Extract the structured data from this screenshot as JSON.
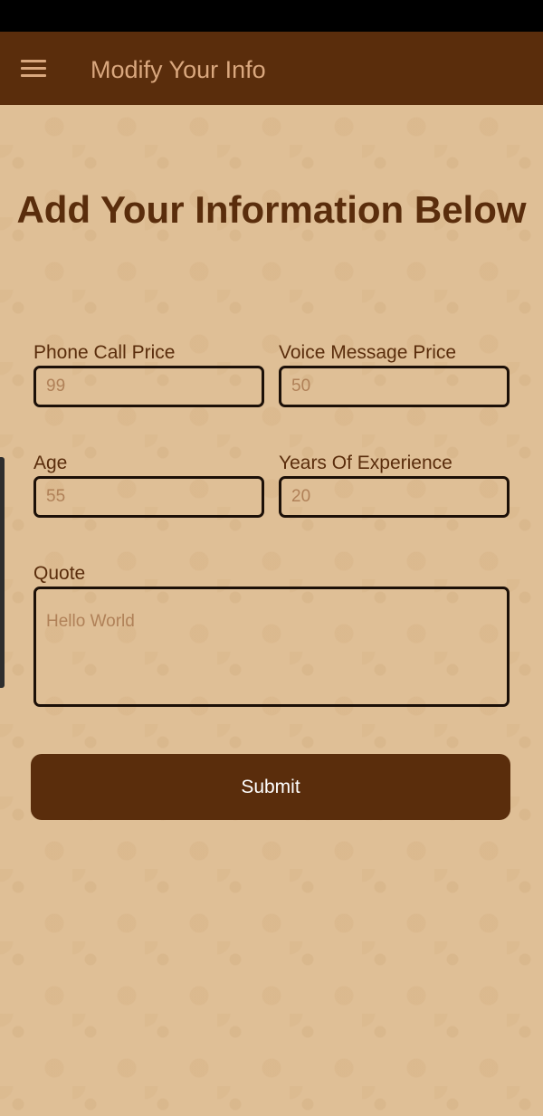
{
  "app_bar": {
    "title": "Modify Your Info",
    "menu_icon": "hamburger-menu-icon"
  },
  "heading": "Add Your Information Below",
  "form": {
    "phone_call_price": {
      "label": "Phone Call Price",
      "placeholder": "99"
    },
    "voice_message_price": {
      "label": "Voice Message Price",
      "placeholder": "50"
    },
    "age": {
      "label": "Age",
      "placeholder": "55"
    },
    "years_of_experience": {
      "label": "Years Of Experience",
      "placeholder": "20"
    },
    "quote": {
      "label": "Quote",
      "placeholder": "Hello World"
    },
    "submit_label": "Submit"
  },
  "colors": {
    "primary": "#5a2d0c",
    "background": "#dfbf96",
    "app_title": "#d9a77e",
    "placeholder": "#b08158"
  }
}
